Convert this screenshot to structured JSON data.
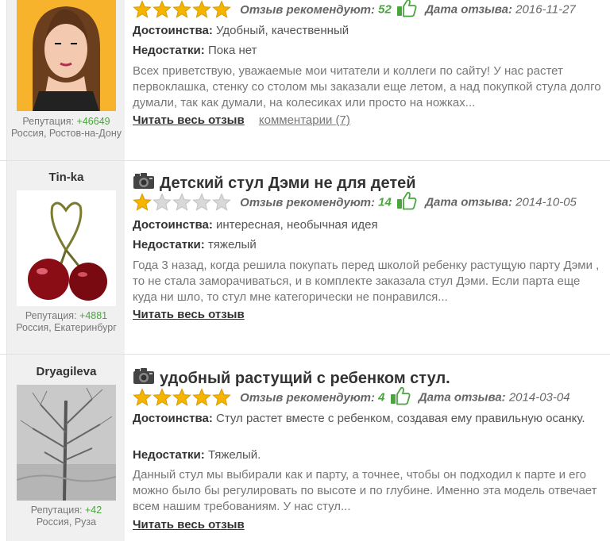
{
  "reviews": [
    {
      "username": "",
      "reputation_label": "Репутация:",
      "reputation_value": "+46649",
      "location": "Россия, Ростов-на-Дону",
      "title": "",
      "stars": 5,
      "recommend_label": "Отзыв рекомендуют:",
      "recommend_count": "52",
      "date_label": "Дата отзыва:",
      "date": "2016-11-27",
      "pros_label": "Достоинства:",
      "pros": "Удобный, качественный",
      "cons_label": "Недостатки:",
      "cons": "Пока нет",
      "text": "Всех приветствую, уважаемые мои читатели и коллеги по сайту! У нас растет первоклашка, стенку со столом мы заказали еще летом, а над покупкой стула долго думали, так как думали, на колесиках или просто на ножках...",
      "read_more": "Читать весь отзыв",
      "comments": "комментарии (7)"
    },
    {
      "username": "Tin-ka",
      "reputation_label": "Репутация:",
      "reputation_value": "+4881",
      "location": "Россия, Екатеринбург",
      "title": "Детский стул Дэми не для детей",
      "stars": 1,
      "recommend_label": "Отзыв рекомендуют:",
      "recommend_count": "14",
      "date_label": "Дата отзыва:",
      "date": "2014-10-05",
      "pros_label": "Достоинства:",
      "pros": "интересная, необычная идея",
      "cons_label": "Недостатки:",
      "cons": "тяжелый",
      "text": "Года 3 назад, когда решила покупать перед школой ребенку растущую парту Дэми , то не стала заморачиваться, и в комплекте заказала стул Дэми. Если парта еще куда ни шло, то стул мне категорически не понравился...",
      "read_more": "Читать весь отзыв"
    },
    {
      "username": "Dryagileva",
      "reputation_label": "Репутация:",
      "reputation_value": "+42",
      "location": "Россия, Руза",
      "title": "удобный растущий с ребенком стул.",
      "stars": 5,
      "recommend_label": "Отзыв рекомендуют:",
      "recommend_count": "4",
      "date_label": "Дата отзыва:",
      "date": "2014-03-04",
      "pros_label": "Достоинства:",
      "pros": "Стул растет вместе с ребенком, создавая ему правильную осанку.",
      "cons_label": "Недостатки:",
      "cons": "Тяжелый.",
      "text": "Данный стул мы выбирали как и парту, а точнее, чтобы он подходил к парте и его можно было бы регулировать по высоте и по глубине. Именно эта модель отвечает всем нашим требованиям. У нас стул...",
      "read_more": "Читать весь отзыв"
    }
  ],
  "icons": {
    "star_filled_color": "#f5b400",
    "star_empty_color": "#d9d9d9",
    "thumb_color": "#4aa53f",
    "camera": "camera-icon",
    "thumbs_up": "thumbs-up-icon",
    "star": "star-icon"
  }
}
